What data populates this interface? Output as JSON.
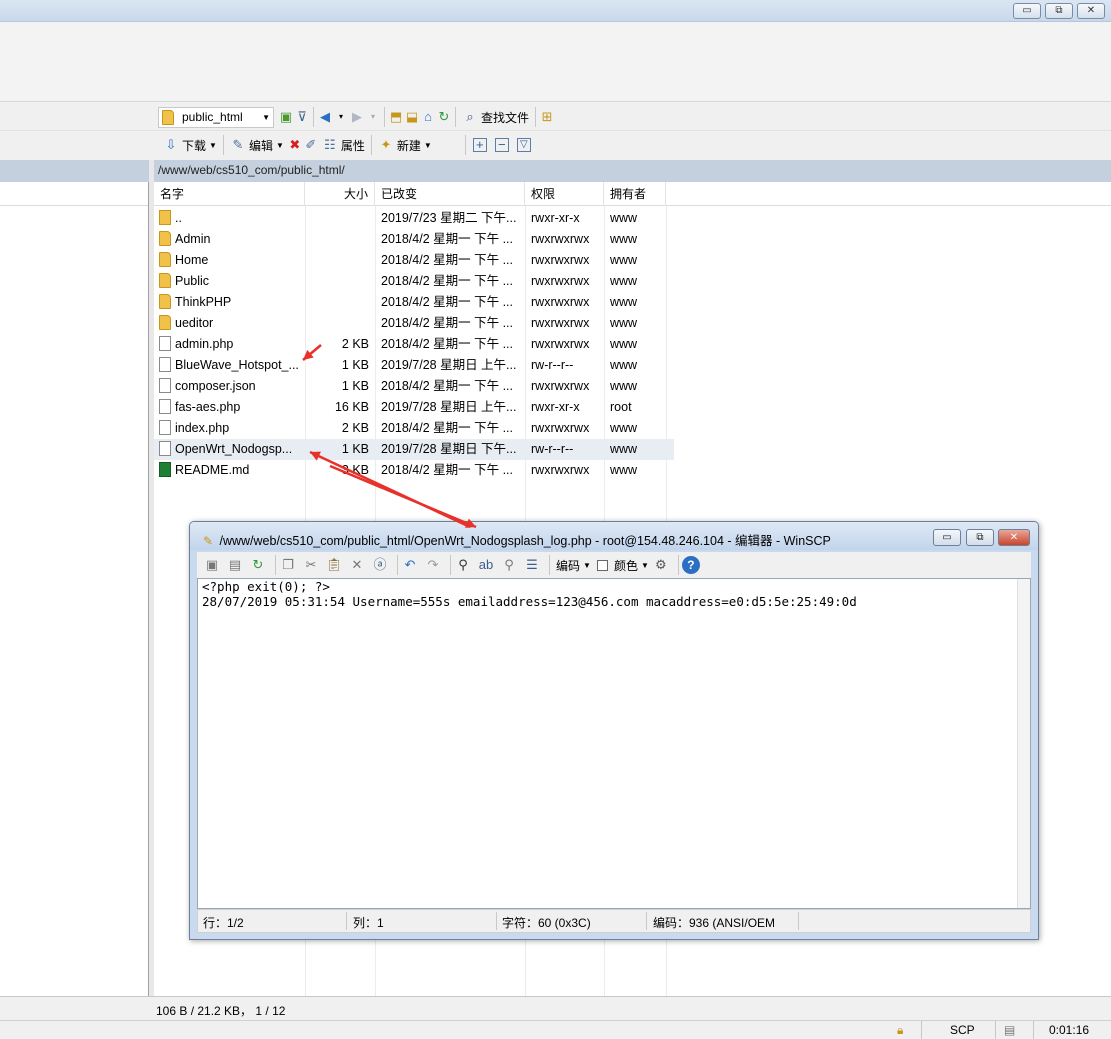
{
  "window": {
    "min_label": "▭",
    "restore_label": "⧉",
    "close_label": "✕"
  },
  "toolbar1": {
    "folder_select": "public_html",
    "find_files": "查找文件"
  },
  "toolbar2": {
    "download": "下载",
    "edit": "编辑",
    "properties": "属性",
    "new": "新建"
  },
  "path": "/www/web/cs510_com/public_html/",
  "columns": {
    "name": "名字",
    "size": "大小",
    "changed": "已改变",
    "rights": "权限",
    "owner": "拥有者"
  },
  "files": [
    {
      "name": "..",
      "size": "",
      "changed": "2019/7/23 星期二 下午...",
      "rights": "rwxr-xr-x",
      "owner": "www",
      "kind": "up"
    },
    {
      "name": "Admin",
      "size": "",
      "changed": "2018/4/2 星期一 下午 ...",
      "rights": "rwxrwxrwx",
      "owner": "www",
      "kind": "folder"
    },
    {
      "name": "Home",
      "size": "",
      "changed": "2018/4/2 星期一 下午 ...",
      "rights": "rwxrwxrwx",
      "owner": "www",
      "kind": "folder"
    },
    {
      "name": "Public",
      "size": "",
      "changed": "2018/4/2 星期一 下午 ...",
      "rights": "rwxrwxrwx",
      "owner": "www",
      "kind": "folder"
    },
    {
      "name": "ThinkPHP",
      "size": "",
      "changed": "2018/4/2 星期一 下午 ...",
      "rights": "rwxrwxrwx",
      "owner": "www",
      "kind": "folder"
    },
    {
      "name": "ueditor",
      "size": "",
      "changed": "2018/4/2 星期一 下午 ...",
      "rights": "rwxrwxrwx",
      "owner": "www",
      "kind": "folder"
    },
    {
      "name": "admin.php",
      "size": "2 KB",
      "changed": "2018/4/2 星期一 下午 ...",
      "rights": "rwxrwxrwx",
      "owner": "www",
      "kind": "doc"
    },
    {
      "name": "BlueWave_Hotspot_...",
      "size": "1 KB",
      "changed": "2019/7/28 星期日 上午...",
      "rights": "rw-r--r--",
      "owner": "www",
      "kind": "doc"
    },
    {
      "name": "composer.json",
      "size": "1 KB",
      "changed": "2018/4/2 星期一 下午 ...",
      "rights": "rwxrwxrwx",
      "owner": "www",
      "kind": "doc"
    },
    {
      "name": "fas-aes.php",
      "size": "16 KB",
      "changed": "2019/7/28 星期日 上午...",
      "rights": "rwxr-xr-x",
      "owner": "root",
      "kind": "doc"
    },
    {
      "name": "index.php",
      "size": "2 KB",
      "changed": "2018/4/2 星期一 下午 ...",
      "rights": "rwxrwxrwx",
      "owner": "www",
      "kind": "doc"
    },
    {
      "name": "OpenWrt_Nodogsp...",
      "size": "1 KB",
      "changed": "2019/7/28 星期日 下午...",
      "rights": "rw-r--r--",
      "owner": "www",
      "kind": "doc"
    },
    {
      "name": "README.md",
      "size": "3 KB",
      "changed": "2018/4/2 星期一 下午 ...",
      "rights": "rwxrwxrwx",
      "owner": "www",
      "kind": "md"
    }
  ],
  "status": {
    "summary": "106 B / 21.2 KB， 1 / 12",
    "protocol": "SCP",
    "elapsed": "0:01:16"
  },
  "editor": {
    "title": "/www/web/cs510_com/public_html/OpenWrt_Nodogsplash_log.php - root@154.48.246.104 - 编辑器 - WinSCP",
    "encoding": "编码",
    "color": "颜色",
    "content": "<?php exit(0); ?>\n28/07/2019 05:31:54 Username=555s emailaddress=123@456.com macaddress=e0:d5:5e:25:49:0d",
    "status_line": "行：1/2",
    "status_col": "列：1",
    "status_char": "字符：60 (0x3C)",
    "status_enc": "编码：936   (ANSI/OEM"
  },
  "colors": {
    "annotation_arrow": "#e8312a"
  }
}
